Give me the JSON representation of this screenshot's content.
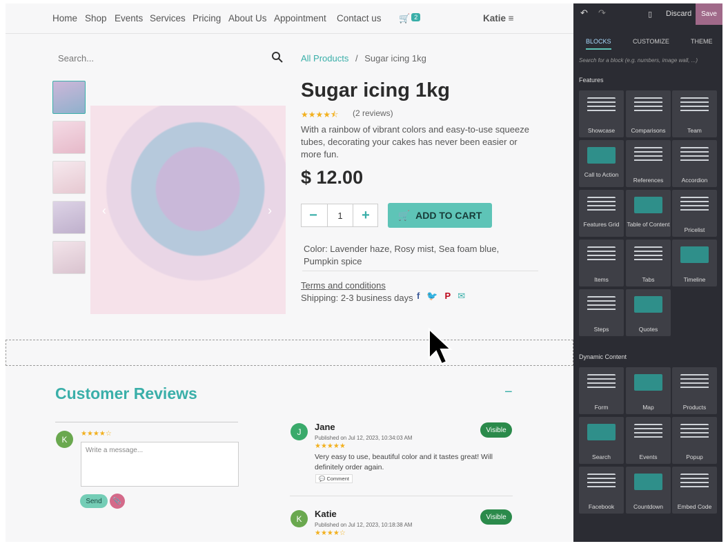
{
  "nav": {
    "items": [
      "Home",
      "Shop",
      "Events",
      "Services",
      "Pricing",
      "About Us",
      "Appointment",
      "Contact us"
    ],
    "cart_count": "2",
    "user": "Katie"
  },
  "search": {
    "placeholder": "Search..."
  },
  "breadcrumb": {
    "parent": "All Products",
    "separator": "/",
    "current": "Sugar icing 1kg"
  },
  "product": {
    "title": "Sugar icing 1kg",
    "rating_stars": "★★★★⯪",
    "reviews_count": "(2 reviews)",
    "description": "With a rainbow of vibrant colors and easy-to-use squeeze tubes, decorating your cakes has never been easier or more fun.",
    "price": "$ 12.00",
    "quantity": "1",
    "add_to_cart": "ADD TO CART",
    "colors": "Color: Lavender haze, Rosy mist, Sea foam blue, Pumpkin spice",
    "terms": "Terms and conditions",
    "shipping": "Shipping: 2-3 business days"
  },
  "reviews": {
    "title": "Customer Reviews",
    "new_avatar": "K",
    "new_stars": "★★★★☆",
    "message_placeholder": "Write a message...",
    "send": "Send",
    "items": [
      {
        "avatar": "J",
        "name": "Jane",
        "date": "Published on Jul 12, 2023, 10:34:03 AM",
        "stars": "★★★★★",
        "text": "Very easy to use, beautiful color and it tastes great! Will definitely order again.",
        "comment": "Comment",
        "status": "Visible"
      },
      {
        "avatar": "K",
        "name": "Katie",
        "date": "Published on Jul 12, 2023, 10:18:38 AM",
        "stars": "★★★★☆",
        "status": "Visible"
      }
    ]
  },
  "editor": {
    "discard": "Discard",
    "save": "Save",
    "tabs": [
      "BLOCKS",
      "CUSTOMIZE",
      "THEME"
    ],
    "search_placeholder": "Search for a block (e.g. numbers, image wall, ...)",
    "section_features": "Features",
    "features": [
      "Showcase",
      "Comparisons",
      "Team",
      "Call to Action",
      "References",
      "Accordion",
      "Features Grid",
      "Table of Content",
      "Pricelist",
      "Items",
      "Tabs",
      "Timeline",
      "Steps",
      "Quotes"
    ],
    "section_dynamic": "Dynamic Content",
    "dynamic": [
      "Form",
      "Map",
      "Products",
      "Search",
      "Events",
      "Popup",
      "Facebook",
      "Countdown",
      "Embed Code"
    ]
  },
  "colors": {
    "accent": "#3aafa9",
    "editor_bg": "#2b2c33",
    "block_bg": "#3e3f46",
    "save": "#a06989",
    "visible": "#2b8a4b"
  }
}
